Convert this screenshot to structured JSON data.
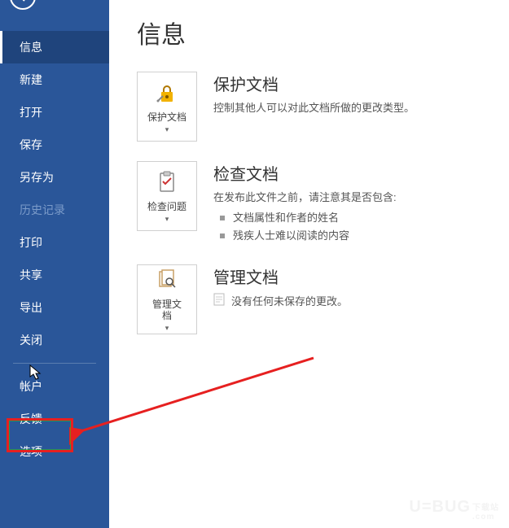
{
  "sidebar": {
    "items": [
      {
        "label": "信息"
      },
      {
        "label": "新建"
      },
      {
        "label": "打开"
      },
      {
        "label": "保存"
      },
      {
        "label": "另存为"
      },
      {
        "label": "历史记录"
      },
      {
        "label": "打印"
      },
      {
        "label": "共享"
      },
      {
        "label": "导出"
      },
      {
        "label": "关闭"
      }
    ],
    "lower": [
      {
        "label": "帐户"
      },
      {
        "label": "反馈"
      },
      {
        "label": "选项"
      }
    ]
  },
  "page": {
    "title": "信息"
  },
  "sections": {
    "protect": {
      "tile_label": "保护文档",
      "title": "保护文档",
      "desc": "控制其他人可以对此文档所做的更改类型。"
    },
    "inspect": {
      "tile_label": "检查问题",
      "title": "检查文档",
      "desc": "在发布此文件之前，请注意其是否包含:",
      "bullets": [
        "文档属性和作者的姓名",
        "残疾人士难以阅读的内容"
      ]
    },
    "manage": {
      "tile_label": "管理文\n档",
      "title": "管理文档",
      "line": "没有任何未保存的更改。"
    }
  },
  "watermark": {
    "text": "U=BUG",
    "sub": "下载站\n.com"
  }
}
